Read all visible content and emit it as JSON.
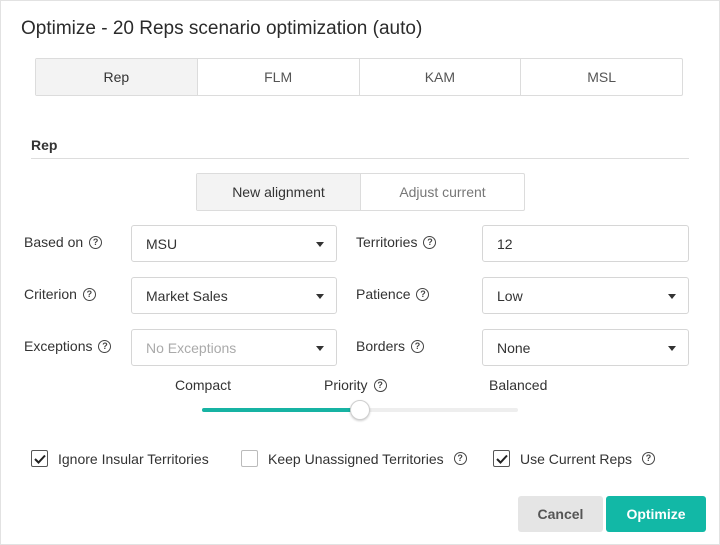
{
  "dialog": {
    "title": "Optimize - 20 Reps scenario optimization (auto)"
  },
  "tabs": [
    {
      "label": "Rep",
      "active": true
    },
    {
      "label": "FLM",
      "active": false
    },
    {
      "label": "KAM",
      "active": false
    },
    {
      "label": "MSL",
      "active": false
    }
  ],
  "section": {
    "title": "Rep"
  },
  "mode_toggle": {
    "new_alignment": "New alignment",
    "adjust_current": "Adjust current",
    "selected": "New alignment"
  },
  "form": {
    "based_on": {
      "label": "Based on",
      "value": "MSU"
    },
    "territories": {
      "label": "Territories",
      "value": "12"
    },
    "criterion": {
      "label": "Criterion",
      "value": "Market Sales"
    },
    "patience": {
      "label": "Patience",
      "value": "Low"
    },
    "exceptions": {
      "label": "Exceptions",
      "placeholder": "No Exceptions"
    },
    "borders": {
      "label": "Borders",
      "value": "None"
    }
  },
  "priority_slider": {
    "label": "Priority",
    "left_label": "Compact",
    "right_label": "Balanced",
    "value_fraction": 0.5
  },
  "checkboxes": {
    "ignore_insular": {
      "label": "Ignore Insular Territories",
      "checked": true
    },
    "keep_unassigned": {
      "label": "Keep Unassigned Territories",
      "checked": false
    },
    "use_current_reps": {
      "label": "Use Current Reps",
      "checked": true
    }
  },
  "buttons": {
    "cancel": "Cancel",
    "optimize": "Optimize"
  },
  "icons": {
    "help": "question-circle-icon",
    "dropdown": "chevron-down-icon",
    "check": "checkmark-icon"
  },
  "colors": {
    "accent": "#12b8a6",
    "cancel_bg": "#e5e5e5"
  }
}
